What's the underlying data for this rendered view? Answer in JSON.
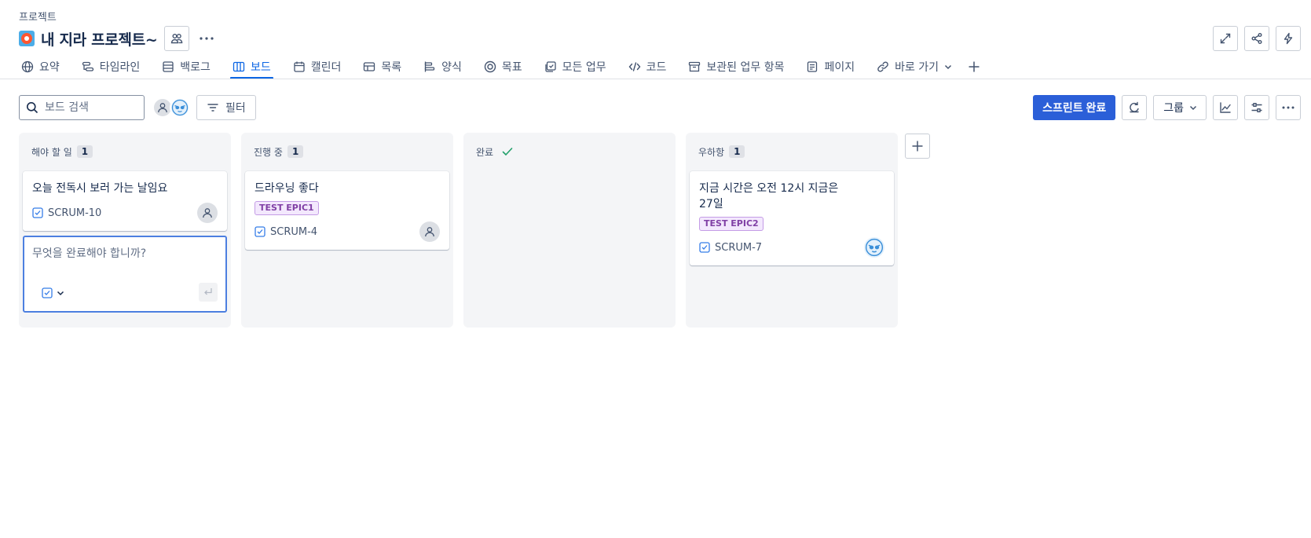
{
  "breadcrumb": "프로젝트",
  "project": {
    "title": "내 지라 프로젝트~"
  },
  "tabs": [
    {
      "label": "요약",
      "icon": "globe-icon"
    },
    {
      "label": "타임라인",
      "icon": "timeline-icon"
    },
    {
      "label": "백로그",
      "icon": "backlog-icon"
    },
    {
      "label": "보드",
      "icon": "board-icon",
      "active": true
    },
    {
      "label": "캘린더",
      "icon": "calendar-icon"
    },
    {
      "label": "목록",
      "icon": "list-icon"
    },
    {
      "label": "양식",
      "icon": "form-icon"
    },
    {
      "label": "목표",
      "icon": "target-icon"
    },
    {
      "label": "모든 업무",
      "icon": "all-work-icon"
    },
    {
      "label": "코드",
      "icon": "code-icon"
    },
    {
      "label": "보관된 업무 항목",
      "icon": "archive-icon"
    },
    {
      "label": "페이지",
      "icon": "page-icon"
    },
    {
      "label": "바로 가기",
      "icon": "link-icon"
    }
  ],
  "toolbar": {
    "search_placeholder": "보드 검색",
    "filter_label": "필터",
    "complete_sprint_label": "스프린트 완료",
    "group_label": "그룹"
  },
  "columns": [
    {
      "title": "해야 할 일",
      "count": "1"
    },
    {
      "title": "진행 중",
      "count": "1"
    },
    {
      "title": "완료",
      "count": ""
    },
    {
      "title": "우하항",
      "count": "1"
    }
  ],
  "cards": {
    "todo": {
      "title": "오늘 전독시 보러 가는 날임요",
      "key": "SCRUM-10"
    },
    "inprogress": {
      "title": "드라우닝 좋다",
      "epic": "TEST EPIC1",
      "key": "SCRUM-4"
    },
    "custom": {
      "title": "지금 시간은 오전 12시 지금은 27일",
      "epic": "TEST EPIC2",
      "key": "SCRUM-7"
    }
  },
  "create": {
    "placeholder": "무엇을 완료해야 합니까?"
  },
  "colors": {
    "primary": "#2b5fd8",
    "active_tab": "#0c66e4",
    "epic_text": "#803fa5",
    "done_check": "#22a06b"
  }
}
